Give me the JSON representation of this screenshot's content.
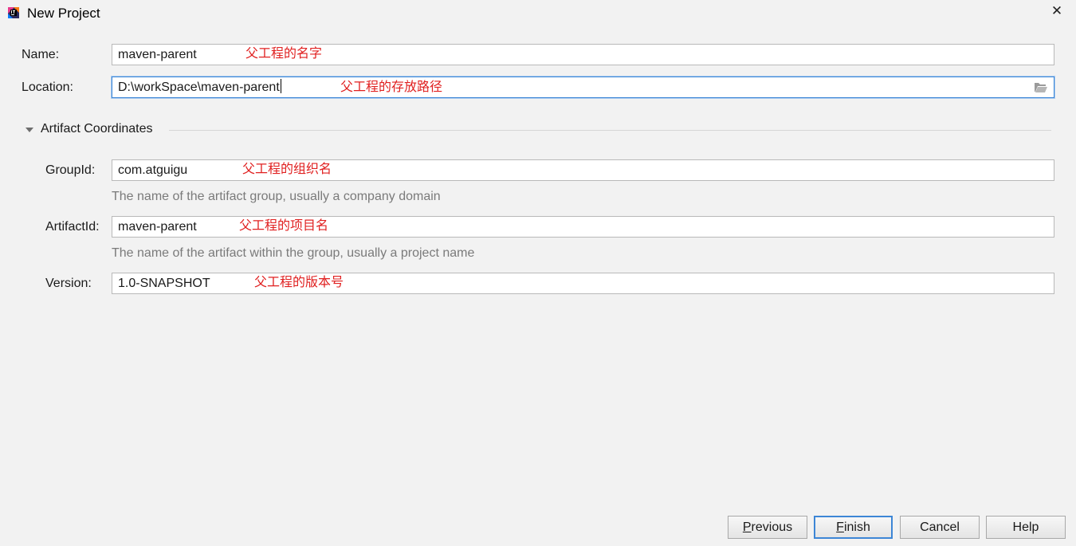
{
  "window": {
    "title": "New Project",
    "close_glyph": "✕",
    "icon": "intellij-idea-icon"
  },
  "form": {
    "name": {
      "label": "Name:",
      "value": "maven-parent",
      "annotation": "父工程的名字"
    },
    "location": {
      "label": "Location:",
      "value": "D:\\workSpace\\maven-parent",
      "annotation": "父工程的存放路径",
      "browse_icon": "folder-open-icon"
    }
  },
  "artifact_section": {
    "title": "Artifact Coordinates",
    "expanded": true,
    "group_id": {
      "label": "GroupId:",
      "value": "com.atguigu",
      "annotation": "父工程的组织名",
      "hint": "The name of the artifact group, usually a company domain"
    },
    "artifact_id": {
      "label": "ArtifactId:",
      "value": "maven-parent",
      "annotation": "父工程的项目名",
      "hint": "The name of the artifact within the group, usually a project name"
    },
    "version": {
      "label": "Version:",
      "value": "1.0-SNAPSHOT",
      "annotation": "父工程的版本号"
    }
  },
  "buttons": {
    "previous": {
      "mnemonic": "P",
      "rest": "revious"
    },
    "finish": {
      "mnemonic": "F",
      "rest": "inish"
    },
    "cancel": "Cancel",
    "help": "Help"
  },
  "colors": {
    "annotation": "#e02020",
    "focus_border": "#3d86d6",
    "hint_text": "#7a7a7a",
    "background": "#f2f2f2"
  }
}
